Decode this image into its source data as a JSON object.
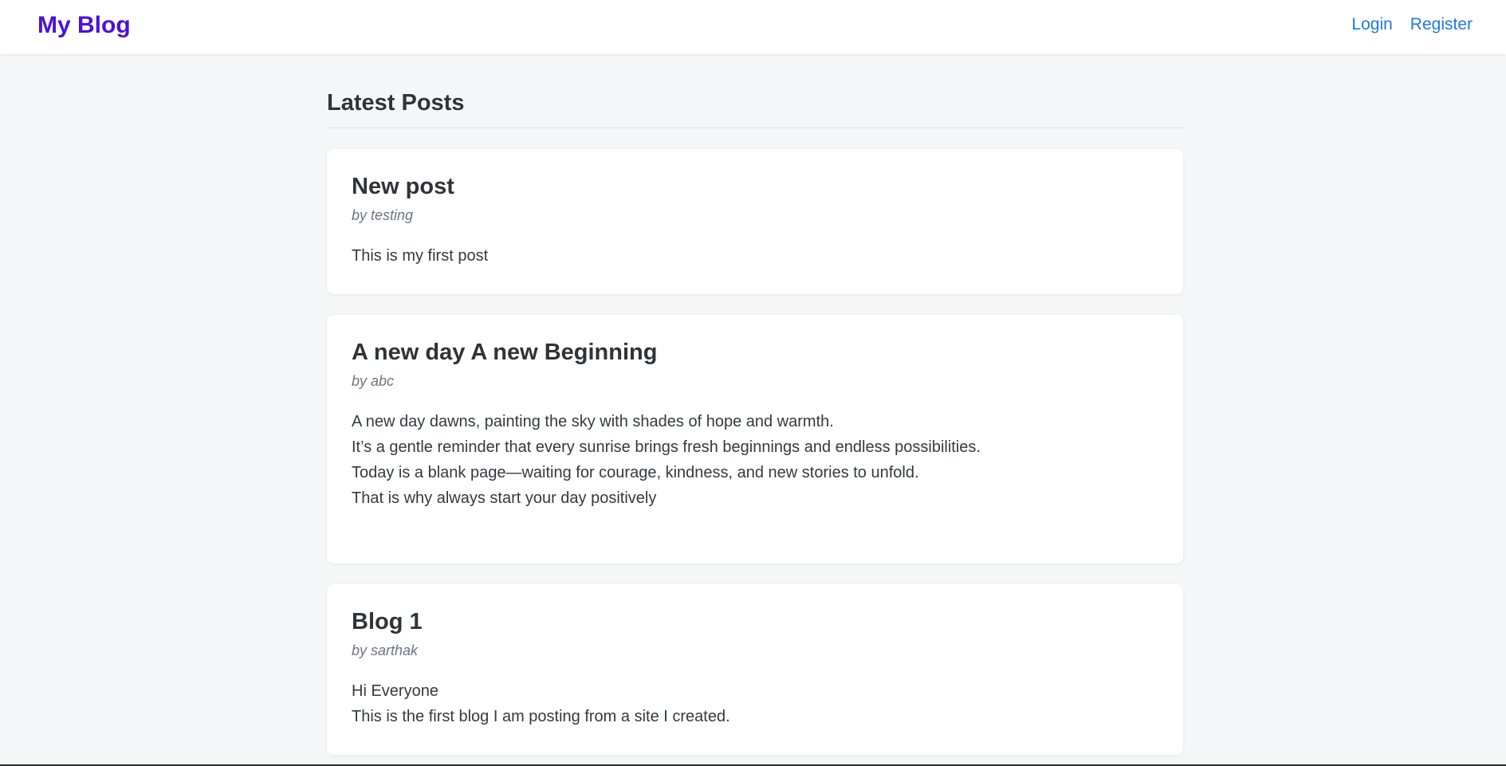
{
  "navbar": {
    "brand": "My Blog",
    "links": [
      {
        "label": "Login"
      },
      {
        "label": "Register"
      }
    ]
  },
  "main": {
    "heading": "Latest Posts",
    "posts": [
      {
        "title": "New post",
        "author": "by testing",
        "body": [
          "This is my first post"
        ]
      },
      {
        "title": "A new day A new Beginning",
        "author": "by abc",
        "body": [
          "A new day dawns, painting the sky with shades of hope and warmth.",
          "It’s a gentle reminder that every sunrise brings fresh beginnings and endless possibilities.",
          "Today is a blank page—waiting for courage, kindness, and new stories to unfold.",
          "That is why always start your day positively"
        ]
      },
      {
        "title": "Blog 1",
        "author": "by sarthak",
        "body": [
          "Hi Everyone",
          "This is the first blog I am posting from a site I created."
        ]
      }
    ]
  },
  "colors": {
    "brand": "#4b11d9",
    "link": "#1f7ae0",
    "background": "#f5f6f8",
    "card": "#ffffff"
  }
}
